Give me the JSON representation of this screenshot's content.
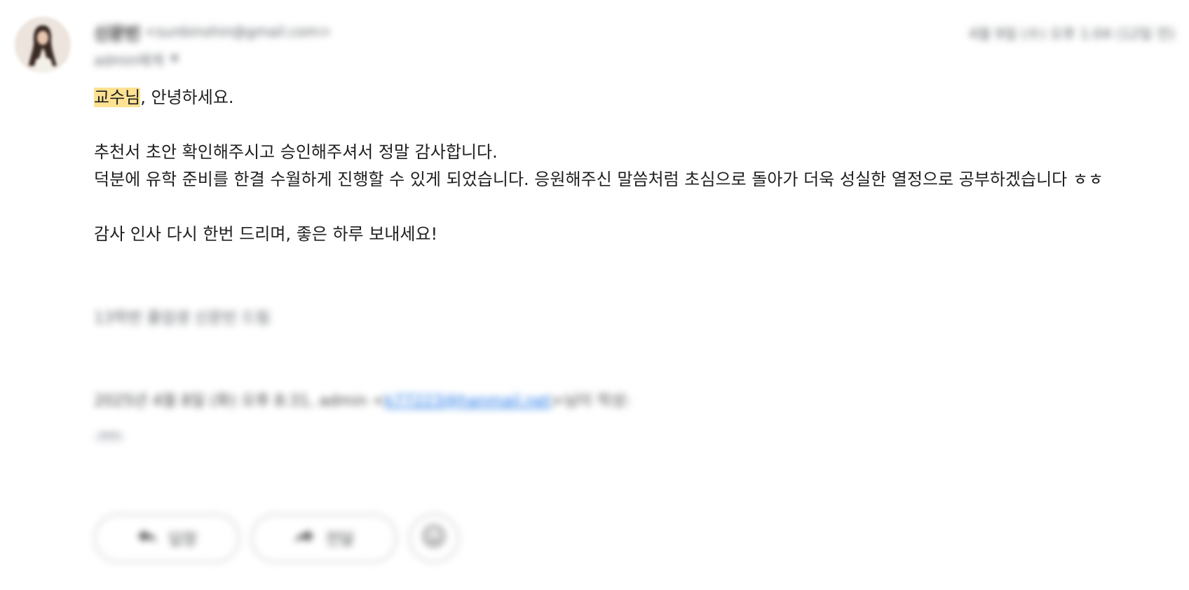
{
  "email": {
    "sender_name": "신문빈",
    "sender_email": "<sunbinshin@gmail.com>",
    "recipient": "admin에게",
    "date": "4월 9일 (수) 오후 1:04 (12일 전)",
    "body": {
      "greeting_highlight": "교수님",
      "greeting_rest": ", 안녕하세요.",
      "line1": "추천서 초안 확인해주시고 승인해주셔서 정말 감사합니다.",
      "line2": "덕분에 유학 준비를 한결 수월하게 진행할 수 있게 되었습니다. 응원해주신 말씀처럼 초심으로 돌아가 더욱 성실한 열정으로 공부하겠습니다 ㅎㅎ",
      "line3": "감사 인사 다시 한번 드리며, 좋은 하루 보내세요!"
    },
    "signature": "13학번 졸업생 신문빈 드림",
    "quote": {
      "prefix": "2025년 4월 8일 (화) 오후 8:31, admin <",
      "link": "k77223@hanmail.net",
      "suffix": ">님이 작성:"
    },
    "show_trimmed": "•••"
  },
  "actions": {
    "reply_label": "답장",
    "forward_label": "전달"
  },
  "icons": {
    "reply": "reply-icon",
    "forward": "forward-icon",
    "emoji": "emoji-icon",
    "dropdown": "chevron-down-icon"
  },
  "colors": {
    "highlight": "#fde293",
    "link": "#1a73e8",
    "muted": "#5f6368"
  }
}
